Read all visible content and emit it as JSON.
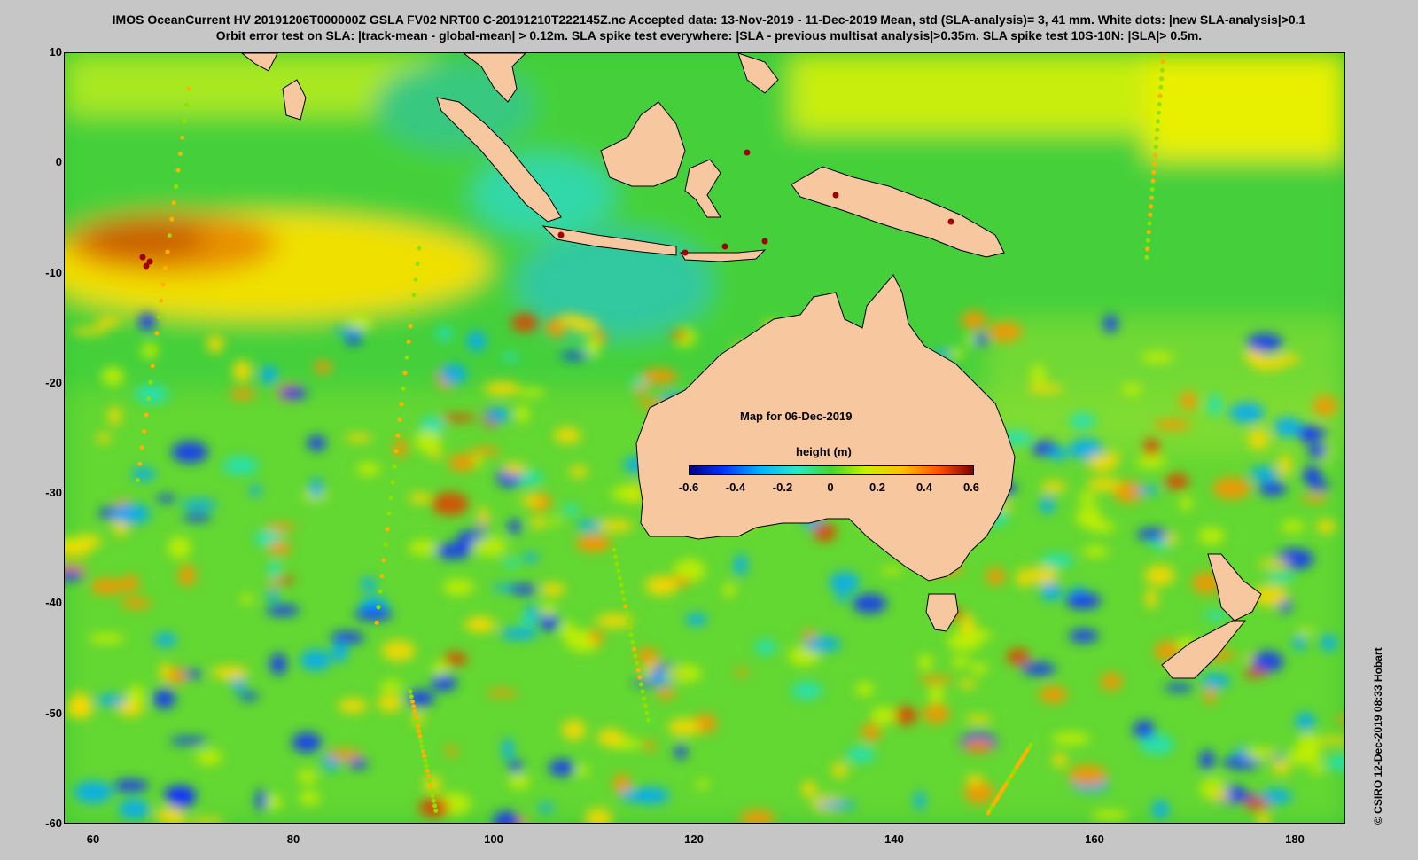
{
  "header": {
    "title_line1": "IMOS OceanCurrent HV 20191206T000000Z GSLA FV02 NRT00 C-20191210T222145Z.nc  Accepted data: 13-Nov-2019 - 11-Dec-2019 Mean, std (SLA-analysis)= 3, 41 mm. White dots: |new SLA-analysis|>0.1",
    "title_line2": "Orbit error test on SLA: |track-mean  - global-mean| > 0.12m.  SLA spike test everywhere: |SLA - previous multisat analysis|>0.35m. SLA spike test 10S-10N: |SLA|> 0.5m."
  },
  "map": {
    "date_label": "Map for 06-Dec-2019",
    "lon_range": [
      57,
      185
    ],
    "lat_range": [
      -60,
      10
    ],
    "lon_ticks": [
      "60",
      "80",
      "100",
      "120",
      "140",
      "160",
      "180"
    ],
    "lat_ticks": [
      "10",
      "0",
      "-10",
      "-20",
      "-30",
      "-40",
      "-50",
      "-60"
    ],
    "land_color": "#f7c79f",
    "ocean_base_color": "#3ec63a"
  },
  "colorbar": {
    "title": "height (m)",
    "labels": [
      "-0.6",
      "-0.4",
      "-0.2",
      "0",
      "0.2",
      "0.4",
      "0.6"
    ],
    "range": [
      -0.6,
      0.6
    ]
  },
  "footer": {
    "credit": "© CSIRO 12-Dec-2019 08:33 Hobart"
  }
}
